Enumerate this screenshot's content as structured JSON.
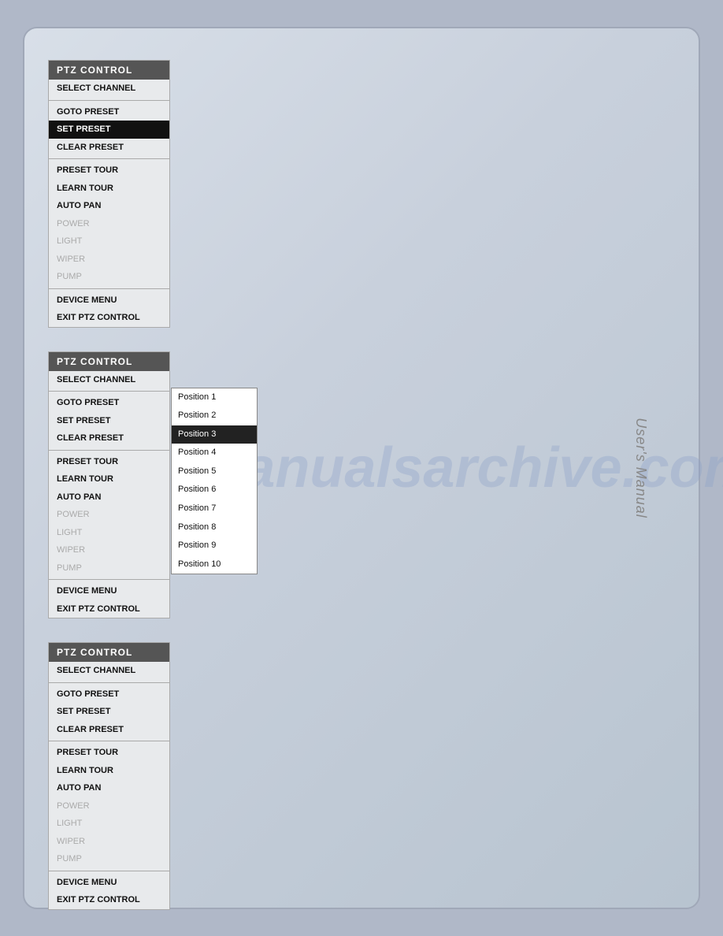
{
  "watermark": "manualsarchive.com",
  "sidebar_label": "User's Manual",
  "menus": [
    {
      "id": "menu1",
      "header": "PTZ CONTROL",
      "items": [
        {
          "label": "SELECT CHANNEL",
          "type": "normal",
          "divider_after": true
        },
        {
          "label": "GOTO PRESET",
          "type": "normal"
        },
        {
          "label": "SET PRESET",
          "type": "selected"
        },
        {
          "label": "CLEAR PRESET",
          "type": "normal",
          "divider_after": true
        },
        {
          "label": "PRESET TOUR",
          "type": "normal"
        },
        {
          "label": "LEARN TOUR",
          "type": "normal"
        },
        {
          "label": "AUTO PAN",
          "type": "normal"
        },
        {
          "label": "POWER",
          "type": "disabled"
        },
        {
          "label": "LIGHT",
          "type": "disabled"
        },
        {
          "label": "WIPER",
          "type": "disabled"
        },
        {
          "label": "PUMP",
          "type": "disabled",
          "divider_after": true
        },
        {
          "label": "DEVICE MENU",
          "type": "normal"
        },
        {
          "label": "EXIT PTZ CONTROL",
          "type": "normal"
        }
      ],
      "has_dropdown": false
    },
    {
      "id": "menu2",
      "header": "PTZ CONTROL",
      "items": [
        {
          "label": "SELECT CHANNEL",
          "type": "normal",
          "divider_after": true
        },
        {
          "label": "GOTO PRESET",
          "type": "normal"
        },
        {
          "label": "SET PRESET",
          "type": "normal"
        },
        {
          "label": "CLEAR PRESET",
          "type": "normal",
          "divider_after": true
        },
        {
          "label": "PRESET TOUR",
          "type": "normal"
        },
        {
          "label": "LEARN TOUR",
          "type": "normal"
        },
        {
          "label": "AUTO PAN",
          "type": "normal"
        },
        {
          "label": "POWER",
          "type": "disabled"
        },
        {
          "label": "LIGHT",
          "type": "disabled"
        },
        {
          "label": "WIPER",
          "type": "disabled"
        },
        {
          "label": "PUMP",
          "type": "disabled",
          "divider_after": true
        },
        {
          "label": "DEVICE MENU",
          "type": "normal"
        },
        {
          "label": "EXIT PTZ CONTROL",
          "type": "normal"
        }
      ],
      "has_dropdown": true,
      "dropdown_items": [
        {
          "label": "Position 1",
          "selected": false
        },
        {
          "label": "Position 2",
          "selected": false
        },
        {
          "label": "Position 3",
          "selected": true
        },
        {
          "label": "Position 4",
          "selected": false
        },
        {
          "label": "Position 5",
          "selected": false
        },
        {
          "label": "Position 6",
          "selected": false
        },
        {
          "label": "Position 7",
          "selected": false
        },
        {
          "label": "Position 8",
          "selected": false
        },
        {
          "label": "Position 9",
          "selected": false
        },
        {
          "label": "Position 10",
          "selected": false
        }
      ]
    },
    {
      "id": "menu3",
      "header": "PTZ CONTROL",
      "items": [
        {
          "label": "SELECT CHANNEL",
          "type": "normal",
          "divider_after": true
        },
        {
          "label": "GOTO PRESET",
          "type": "normal"
        },
        {
          "label": "SET PRESET",
          "type": "normal"
        },
        {
          "label": "CLEAR PRESET",
          "type": "normal",
          "divider_after": true
        },
        {
          "label": "PRESET TOUR",
          "type": "normal"
        },
        {
          "label": "LEARN TOUR",
          "type": "normal"
        },
        {
          "label": "AUTO PAN",
          "type": "normal"
        },
        {
          "label": "POWER",
          "type": "disabled"
        },
        {
          "label": "LIGHT",
          "type": "disabled"
        },
        {
          "label": "WIPER",
          "type": "disabled"
        },
        {
          "label": "PUMP",
          "type": "disabled",
          "divider_after": true
        },
        {
          "label": "DEVICE MENU",
          "type": "normal"
        },
        {
          "label": "EXIT PTZ CONTROL",
          "type": "normal"
        }
      ],
      "has_dropdown": false
    }
  ]
}
